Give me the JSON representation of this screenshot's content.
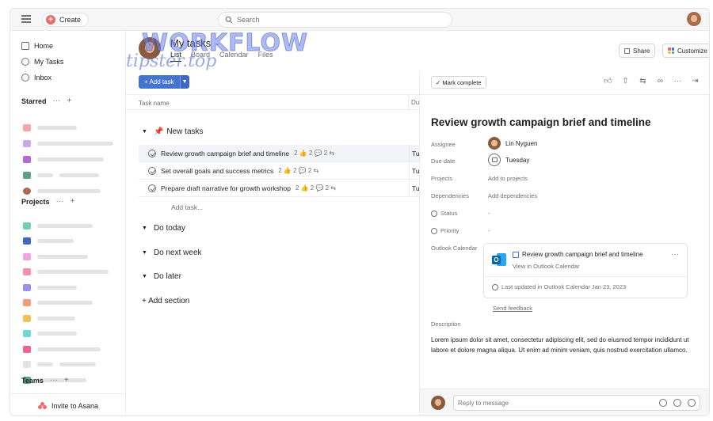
{
  "topbar": {
    "create_label": "Create",
    "search_placeholder": "Search"
  },
  "sidebar": {
    "home": "Home",
    "my_tasks": "My Tasks",
    "inbox": "Inbox",
    "starred": "Starred",
    "projects": "Projects",
    "teams": "Teams",
    "invite": "Invite to Asana",
    "starred_colors": [
      "#f6a6a6",
      "#c9a7f2",
      "#b36bd4",
      "#5da283",
      "#a86b4c"
    ],
    "project_colors": [
      "#6fd0b8",
      "#3f68c2",
      "#f3a4e0",
      "#f48fb1",
      "#9e8fe8",
      "#f39b7a",
      "#f2c15a",
      "#6bd9d9",
      "#f06292",
      "#e3e3e3",
      "#5da283"
    ]
  },
  "header": {
    "title": "My tasks",
    "tabs": [
      "List",
      "Board",
      "Calendar",
      "Files"
    ],
    "share": "Share",
    "customize": "Customize",
    "watermark": "WORKFLOW",
    "watermark_sub": "tipster.top"
  },
  "list": {
    "add_task": "+ Add task",
    "col_task_name": "Task name",
    "col_due": "Du",
    "sections": [
      {
        "name": "New tasks",
        "emoji": "📌"
      },
      {
        "name": "Do today"
      },
      {
        "name": "Do next week"
      },
      {
        "name": "Do later"
      }
    ],
    "tasks": [
      {
        "name": "Review growth campaign brief and timeline",
        "meta": "2 👍  2 💬  2 ⇆",
        "due": "Tu"
      },
      {
        "name": "Set overall goals and success metrics",
        "meta": "2 👍  2 💬  2 ⇆",
        "due": "Tu"
      },
      {
        "name": "Prepare draft narrative for growth workshop",
        "meta": "2 👍  2 💬  2 ⇆",
        "due": "Tu"
      }
    ],
    "add_task_link": "Add task...",
    "add_section": "+ Add section"
  },
  "detail": {
    "mark_complete": "✓ Mark complete",
    "title": "Review growth campaign brief and timeline",
    "labels": {
      "assignee": "Assignee",
      "due_date": "Due date",
      "projects": "Projects",
      "dependencies": "Dependencies",
      "status": "Status",
      "priority": "Priority",
      "outlook": "Outlook Calendar",
      "description": "Description"
    },
    "assignee": "Lin Nyguen",
    "due": "Tuesday",
    "projects_value": "Add to projects",
    "dependencies_value": "Add dependencies",
    "status_value": "-",
    "priority_value": "-",
    "outlook_title": "Review growth campaign brief and timeline",
    "outlook_sub": "View in Outlook Calendar",
    "outlook_updated": "Last updated in Outlook Calendar Jan 23, 2023",
    "feedback": "Send feedback",
    "description": "Lorem ipsum dolor sit amet, consectetur adipiscing elit, sed do eiusmod tempor incididunt ut labore et dolore magna aliqua. Ut enim ad minim veniam, quis nostrud exercitation ullamco.",
    "reply_placeholder": "Reply to message"
  }
}
